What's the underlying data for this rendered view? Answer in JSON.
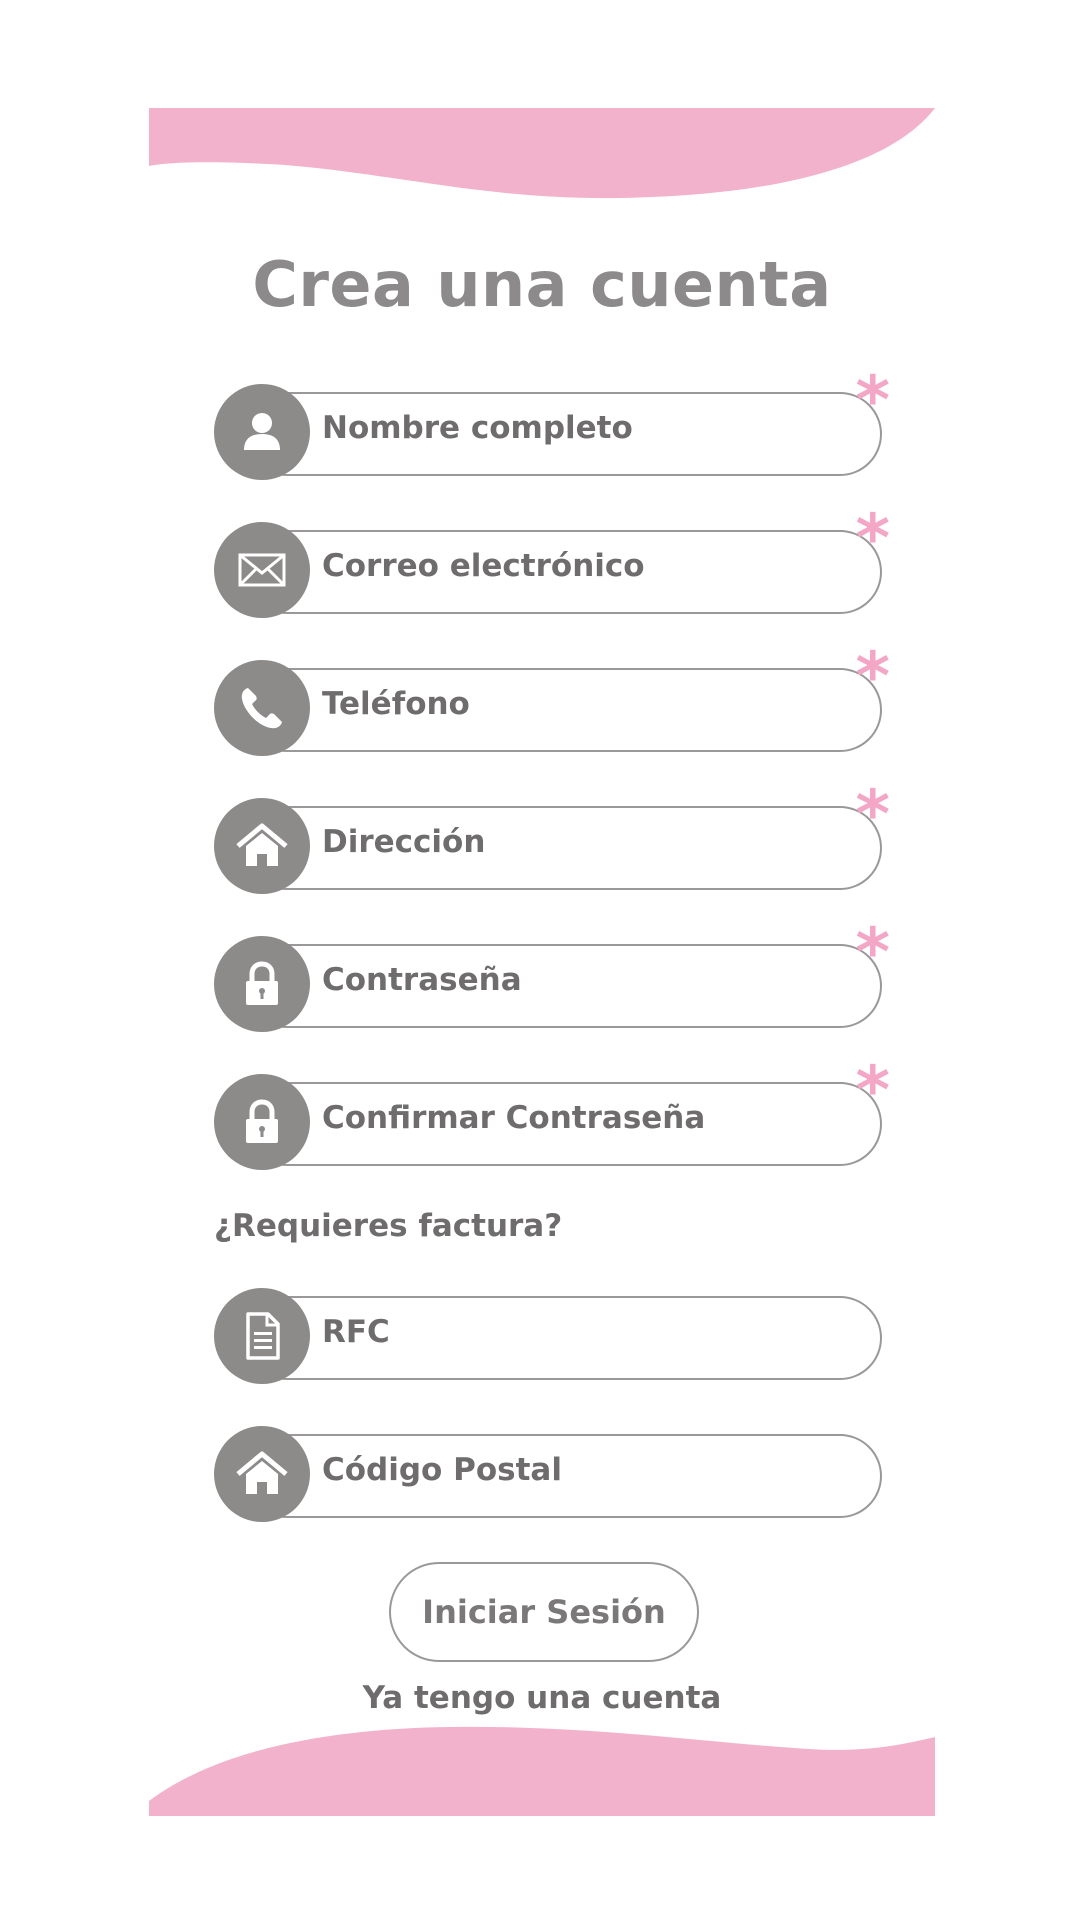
{
  "page": {
    "title": "Crea una cuenta"
  },
  "theme": {
    "accent": "#f3b2cb",
    "icon_bg": "#8d8a8a",
    "text": "#6e6c6c"
  },
  "fields": [
    {
      "label": "Nombre completo",
      "icon": "user-icon",
      "required": true
    },
    {
      "label": "Correo electrónico",
      "icon": "mail-icon",
      "required": true
    },
    {
      "label": "Teléfono",
      "icon": "phone-icon",
      "required": true
    },
    {
      "label": "Dirección",
      "icon": "home-icon",
      "required": true
    },
    {
      "label": "Contraseña",
      "icon": "lock-icon",
      "required": true
    },
    {
      "label": "Confirmar Contraseña",
      "icon": "lock-icon",
      "required": true
    }
  ],
  "required_mark": "*",
  "billing": {
    "question": "¿Requieres factura?",
    "fields": [
      {
        "label": "RFC",
        "icon": "document-icon"
      },
      {
        "label": "Código Postal",
        "icon": "home-icon"
      }
    ]
  },
  "actions": {
    "login_button": "Iniciar Sesión",
    "have_account": "Ya tengo una cuenta"
  }
}
